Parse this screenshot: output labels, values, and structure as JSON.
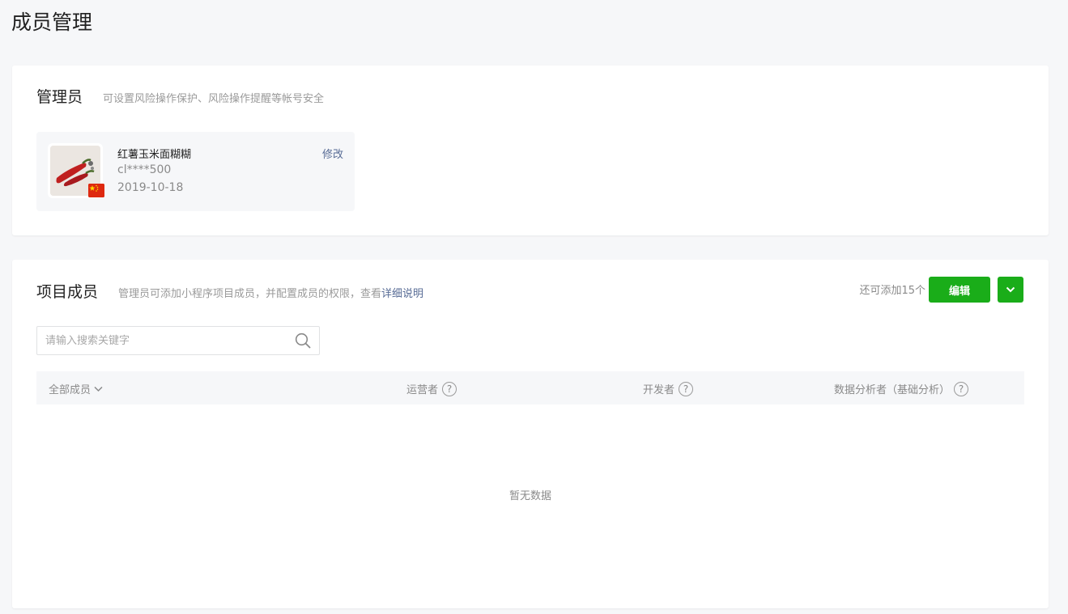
{
  "page": {
    "title": "成员管理"
  },
  "admin_section": {
    "title": "管理员",
    "description": "可设置风险操作保护、风险操作提醒等帐号安全",
    "admin": {
      "name": "红薯玉米面糊糊",
      "account": "cl****500",
      "date": "2019-10-18",
      "edit_label": "修改",
      "avatar_icon": "chili-pepper-avatar",
      "flag_icon": "china-flag-icon"
    }
  },
  "members_section": {
    "title": "项目成员",
    "description": "管理员可添加小程序项目成员，并配置成员的权限，查看",
    "description_link": "详细说明",
    "quota_text": "还可添加15个",
    "edit_button": "编辑",
    "search": {
      "placeholder": "请输入搜索关键字",
      "value": ""
    },
    "table": {
      "filter_label": "全部成员",
      "columns": [
        "运营者",
        "开发者",
        "数据分析者（基础分析）"
      ]
    },
    "empty_text": "暂无数据"
  },
  "colors": {
    "primary": "#1aad19",
    "link": "#576b95",
    "background": "#f6f7f9"
  }
}
